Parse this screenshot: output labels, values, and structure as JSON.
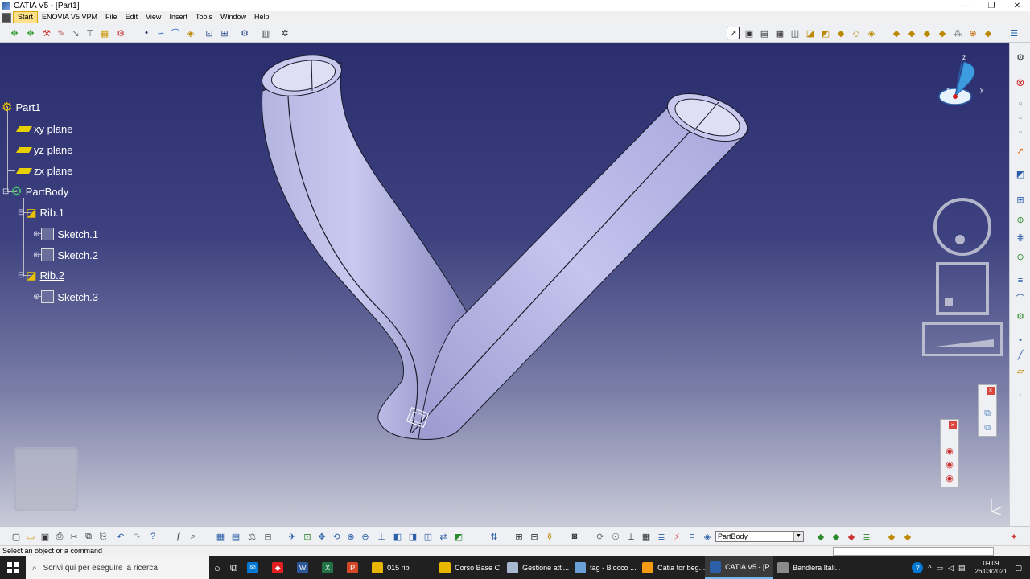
{
  "window": {
    "title": "CATIA V5 - [Part1]",
    "controls": [
      "—",
      "❐",
      "✕"
    ]
  },
  "menubar": {
    "items": [
      "Start",
      "ENOVIA V5 VPM",
      "File",
      "Edit",
      "View",
      "Insert",
      "Tools",
      "Window",
      "Help"
    ]
  },
  "spec_tree": {
    "root": "Part1",
    "planes": [
      "xy plane",
      "yz plane",
      "zx plane"
    ],
    "body": "PartBody",
    "ribs": [
      {
        "label": "Rib.1",
        "sketches": [
          "Sketch.1",
          "Sketch.2"
        ]
      },
      {
        "label": "Rib.2",
        "sketches": [
          "Sketch.3"
        ]
      }
    ]
  },
  "compass": {
    "axes": [
      "z",
      "x",
      "y"
    ]
  },
  "bottom_toolbar": {
    "current_body": "PartBody"
  },
  "statusbar": {
    "message": "Select an object or a command"
  },
  "taskbar": {
    "search_placeholder": "Scrivi qui per eseguire la ricerca",
    "apps": [
      {
        "label": "015 rib",
        "color": "#e8b500"
      },
      {
        "label": "Corso Base C...",
        "color": "#e8b500"
      },
      {
        "label": "Gestione atti...",
        "color": "#a8b8d0"
      },
      {
        "label": "tag - Blocco ...",
        "color": "#6aa0d8"
      },
      {
        "label": "Catia for beg...",
        "color": "#f39c12"
      },
      {
        "label": "CATIA V5 - [P...",
        "color": "#2b5fa8"
      },
      {
        "label": "Bandiera Itali...",
        "color": "#8a8a8a"
      }
    ],
    "time": "09:09",
    "date": "26/03/2021"
  }
}
